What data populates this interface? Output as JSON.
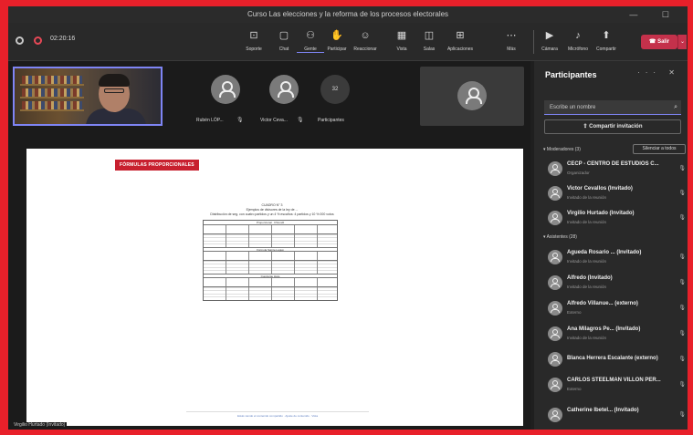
{
  "window": {
    "title": "Curso Las elecciones y la reforma de los procesos electorales",
    "controls": "— ☐"
  },
  "toolbar": {
    "timer": "02:20:16",
    "buttons": [
      {
        "icon": "⊡",
        "label": "Soporte"
      },
      {
        "icon": "▢",
        "label": "Chat"
      },
      {
        "icon": "⚇",
        "label": "Gente"
      },
      {
        "icon": "✋",
        "label": "Participar"
      },
      {
        "icon": "☺",
        "label": "Reaccionar"
      },
      {
        "icon": "▦",
        "label": "Vista"
      },
      {
        "icon": "◫",
        "label": "Salas"
      },
      {
        "icon": "⊞",
        "label": "Aplicaciones"
      },
      {
        "icon": "⋯",
        "label": "Más"
      },
      {
        "icon": "▶",
        "label": "Cámara"
      },
      {
        "icon": "♪",
        "label": "Micrófono"
      },
      {
        "icon": "⬆",
        "label": "Compartir"
      }
    ],
    "leave_label": "Salir",
    "leave_icon": "☎",
    "leave_dropdown": "⌄"
  },
  "stage": {
    "tiles": [
      {
        "name": "Rubén LÓP...",
        "mic": "🎙"
      },
      {
        "name": "Victor Ceva...",
        "mic": "🎙"
      }
    ],
    "participant_count": "32",
    "participant_count_label": "Participantes",
    "presenter_name_label": "Virgilio Hurtado (Invitado)"
  },
  "shared_content": {
    "badge": "FÓRMULAS PROPORCIONALES",
    "doc_title": "CUADRO N° 3",
    "doc_subtitle": "Ejemplos de divisores de la ley de ...",
    "doc_line": "Distribución de seg. con cuatro partidos y un 4 % escaños: 4 partidos y 10 % 000 votos",
    "table_header_1": "Proporcional · D'Hondt",
    "table_header_2": "Fórmula Sainte-Laguë",
    "table_header_3": "Cuociente Hare",
    "footer": "Estás viendo el contenido compartido · Ajuste de contenido · Vista"
  },
  "panel": {
    "title": "Participantes",
    "header_icons": "··· ✕",
    "search_placeholder": "Escribe un nombre",
    "search_icon": "⌕",
    "invite_label": "⇪ Compartir invitación",
    "moderators_label": "▾ Moderadores (3)",
    "mute_all_label": "Silenciar a todos",
    "attendees_label": "▾ Asistentes (28)",
    "moderators": [
      {
        "name": "CECP - CENTRO DE ESTUDIOS C...",
        "role": "Organizador",
        "mic": "🎙"
      },
      {
        "name": "Victor Cevallos (Invitado)",
        "role": "Invitado de la reunión",
        "mic": "🎙"
      },
      {
        "name": "Virgilio Hurtado (Invitado)",
        "role": "Invitado de la reunión",
        "mic": "🎙"
      }
    ],
    "attendees": [
      {
        "name": "Agueda Rosario ... (Invitado)",
        "role": "Invitado de la reunión",
        "mic": "🎙"
      },
      {
        "name": "Alfredo (Invitado)",
        "role": "Invitado de la reunión",
        "mic": "🎙"
      },
      {
        "name": "Alfredo Villanue... (externo)",
        "role": "Externo",
        "mic": "🎙"
      },
      {
        "name": "Ana Milagros Pe... (Invitado)",
        "role": "Invitado de la reunión",
        "mic": "🎙"
      },
      {
        "name": "Blanca Herrera Escalante (externo)",
        "role": "",
        "mic": "🎙"
      },
      {
        "name": "CARLOS STEELMAN VILLON PER...",
        "role": "Externo",
        "mic": "🎙"
      },
      {
        "name": "Catherine Ibetel... (Invitado)",
        "role": "",
        "mic": "🎙"
      }
    ]
  }
}
